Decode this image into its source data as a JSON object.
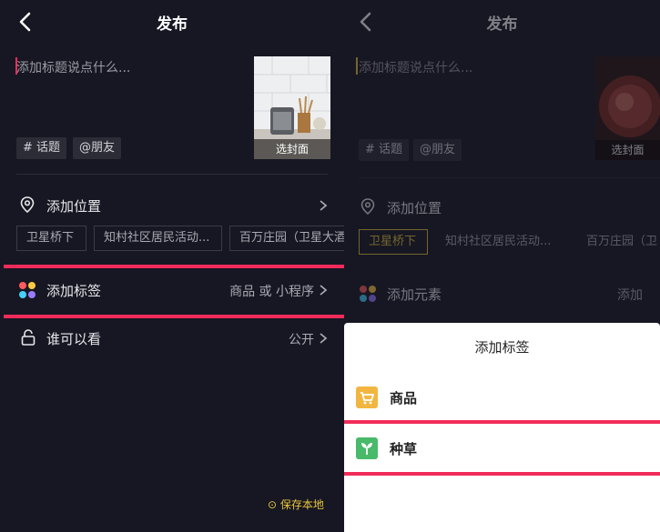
{
  "left": {
    "header_title": "发布",
    "caption_placeholder": "添加标题说点什么...",
    "chips": [
      "# 话题",
      "@朋友"
    ],
    "cover_label": "选封面",
    "location_label": "添加位置",
    "location_chips": [
      "卫星桥下",
      "知村社区居民活动...",
      "百万庄园（卫星大酒"
    ],
    "tag_label": "添加标签",
    "tag_value": "商品 或 小程序",
    "who_label": "谁可以看",
    "who_value": "公开",
    "save_local": "保存本地"
  },
  "right": {
    "header_title": "发布",
    "caption_placeholder": "添加标题说点什么...",
    "chips": [
      "# 话题",
      "@朋友"
    ],
    "cover_label": "选封面",
    "location_label": "添加位置",
    "location_chips": [
      "卫星桥下",
      "知村社区居民活动...",
      "百万庄园（卫"
    ],
    "element_label": "添加元素",
    "element_value": "添加",
    "sheet_title": "添加标签",
    "sheet_items": [
      "商品",
      "种草"
    ]
  },
  "colors": {
    "background": "#161722",
    "accent_pink": "#f12c5a",
    "save_yellow": "#e8c43d",
    "cursor_red": "#f12c5a",
    "cursor_yellow": "#e8c43d",
    "goods_icon_bg": "#f2b640",
    "seed_icon_bg": "#49b96a"
  }
}
